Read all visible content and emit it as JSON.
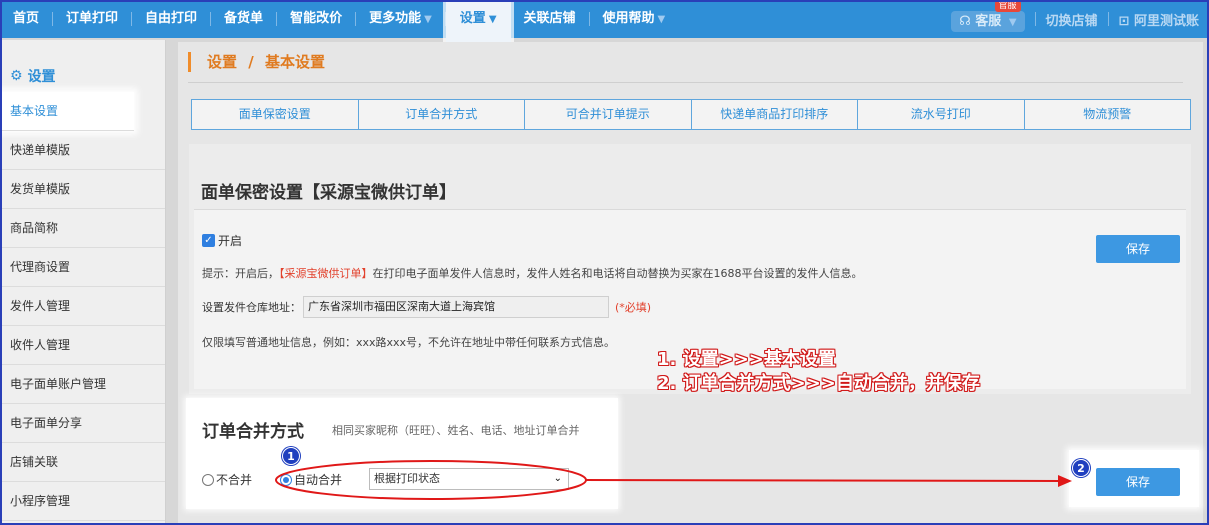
{
  "nav": {
    "items": [
      "首页",
      "订单打印",
      "自由打印",
      "备货单",
      "智能改价",
      "更多功能",
      "设置",
      "关联店铺",
      "使用帮助"
    ],
    "caret": "▼",
    "service": "客服",
    "service_badge": "官服",
    "switch_shop": "切换店铺",
    "account": "阿里测试账"
  },
  "sidebar": {
    "title": "设置",
    "items": [
      "基本设置",
      "快递单模版",
      "发货单模版",
      "商品简称",
      "代理商设置",
      "发件人管理",
      "收件人管理",
      "电子面单账户管理",
      "电子面单分享",
      "店铺关联",
      "小程序管理"
    ]
  },
  "breadcrumb": {
    "parent": "设置",
    "sep": "/",
    "current": "基本设置"
  },
  "tabs": [
    "面单保密设置",
    "订单合并方式",
    "可合并订单提示",
    "快递单商品打印排序",
    "流水号打印",
    "物流预警"
  ],
  "secrecy": {
    "title": "面单保密设置【采源宝微供订单】",
    "enable_label": "开启",
    "tip_prefix": "提示：开启后，",
    "tip_highlight": "【采源宝微供订单】",
    "tip_suffix": "在打印电子面单发件人信息时，发件人姓名和电话将自动替换为买家在1688平台设置的发件人信息。",
    "address_label": "设置发件仓库地址：",
    "address_value": "广东省深圳市福田区深南大道上海宾馆",
    "required": "(*必填)",
    "note": "仅限填写普通地址信息，例如：xxx路xxx号，不允许在地址中带任何联系方式信息。",
    "save": "保存"
  },
  "merge": {
    "title": "订单合并方式",
    "subtitle": "相同买家昵称（旺旺）、姓名、电话、地址订单合并",
    "option_no": "不合并",
    "option_auto": "自动合并",
    "select_value": "根据打印状态",
    "save": "保存"
  },
  "annotation": {
    "line1": "1. 设置>>>基本设置",
    "line2": "2. 订单合并方式>>>自动合并，并保存",
    "marker1": "1",
    "marker2": "2"
  },
  "colors": {
    "nav_bg": "#2f8fd7",
    "accent": "#2f8fd7",
    "crumb": "#e07b20",
    "annot_red": "#e01818",
    "marker": "#1f3fbf"
  }
}
